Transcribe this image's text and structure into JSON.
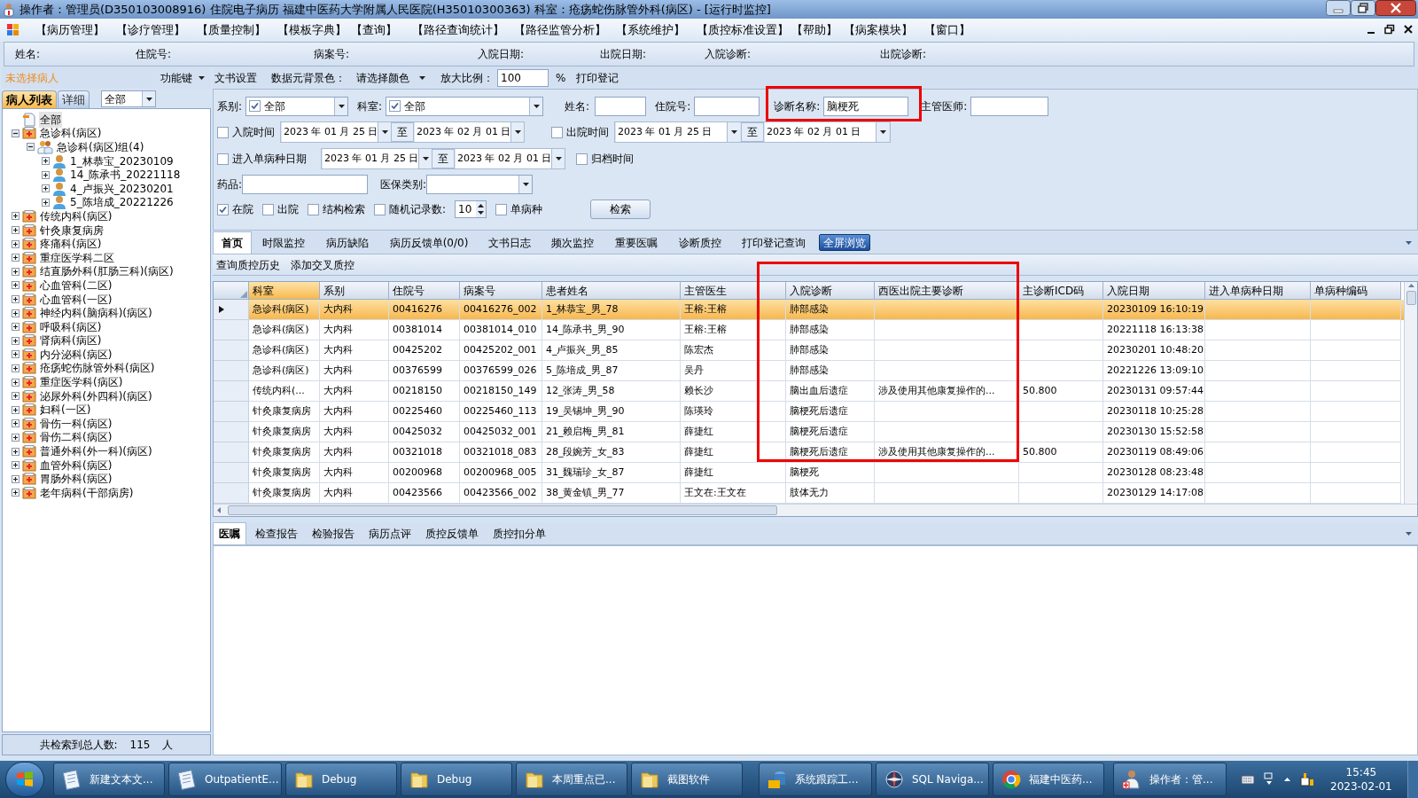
{
  "window": {
    "title": "操作者：管理员(D350103008916) 住院电子病历  福建中医药大学附属人民医院(H35010300363)  科室：疮疡蛇伤脉管外科(病区) - [运行时监控]"
  },
  "menu": [
    "【病历管理】",
    "【诊疗管理】",
    "【质量控制】",
    "【模板字典】",
    "【查询】",
    "【路径查询统计】",
    "【路径监管分析】",
    "【系统维护】",
    "【质控标准设置】",
    "【帮助】",
    "【病案模块】",
    "【窗口】"
  ],
  "patient_header": [
    "姓名:",
    "住院号:",
    "病案号:",
    "入院日期:",
    "出院日期:",
    "入院诊断:",
    "出院诊断:"
  ],
  "left_panel": {
    "status": "未选择病人",
    "function_key": "功能键",
    "tabs": [
      {
        "label": "病人列表",
        "selected": true
      },
      {
        "label": "详细",
        "selected": false
      }
    ],
    "filter": "全部",
    "tree": [
      {
        "label": "全部",
        "kind": "root",
        "selected": true
      },
      {
        "label": "急诊科(病区)",
        "kind": "ward",
        "selected": false,
        "expanded": true,
        "children": [
          {
            "label": "急诊科(病区)组(4)",
            "kind": "group",
            "selected": false,
            "expanded": true,
            "children": [
              {
                "label": "1_林恭宝_20230109",
                "kind": "patient",
                "selected": false,
                "expanded": false
              },
              {
                "label": "14_陈承书_20221118",
                "kind": "patient",
                "selected": false,
                "expanded": false
              },
              {
                "label": "4_卢振兴_20230201",
                "kind": "patient",
                "selected": false,
                "expanded": false
              },
              {
                "label": "5_陈培成_20221226",
                "kind": "patient",
                "selected": false,
                "expanded": false
              }
            ]
          }
        ]
      },
      {
        "label": "传统内科(病区)",
        "kind": "ward",
        "selected": false,
        "expanded": false
      },
      {
        "label": "针灸康复病房",
        "kind": "ward",
        "selected": false,
        "expanded": false
      },
      {
        "label": "疼痛科(病区)",
        "kind": "ward",
        "selected": false,
        "expanded": false
      },
      {
        "label": "重症医学科二区",
        "kind": "ward",
        "selected": false,
        "expanded": false
      },
      {
        "label": "结直肠外科(肛肠三科)(病区)",
        "kind": "ward",
        "selected": false,
        "expanded": false
      },
      {
        "label": "心血管科(二区)",
        "kind": "ward",
        "selected": false,
        "expanded": false
      },
      {
        "label": "心血管科(一区)",
        "kind": "ward",
        "selected": false,
        "expanded": false
      },
      {
        "label": "神经内科(脑病科)(病区)",
        "kind": "ward",
        "selected": false,
        "expanded": false
      },
      {
        "label": "呼吸科(病区)",
        "kind": "ward",
        "selected": false,
        "expanded": false
      },
      {
        "label": "肾病科(病区)",
        "kind": "ward",
        "selected": false,
        "expanded": false
      },
      {
        "label": "内分泌科(病区)",
        "kind": "ward",
        "selected": false,
        "expanded": false
      },
      {
        "label": "疮疡蛇伤脉管外科(病区)",
        "kind": "ward",
        "selected": false,
        "expanded": false
      },
      {
        "label": "重症医学科(病区)",
        "kind": "ward",
        "selected": false,
        "expanded": false
      },
      {
        "label": "泌尿外科(外四科)(病区)",
        "kind": "ward",
        "selected": false,
        "expanded": false
      },
      {
        "label": "妇科(一区)",
        "kind": "ward",
        "selected": false,
        "expanded": false
      },
      {
        "label": "骨伤一科(病区)",
        "kind": "ward",
        "selected": false,
        "expanded": false
      },
      {
        "label": "骨伤二科(病区)",
        "kind": "ward",
        "selected": false,
        "expanded": false
      },
      {
        "label": "普通外科(外一科)(病区)",
        "kind": "ward",
        "selected": false,
        "expanded": false
      },
      {
        "label": "血管外科(病区)",
        "kind": "ward",
        "selected": false,
        "expanded": false
      },
      {
        "label": "胃肠外科(病区)",
        "kind": "ward",
        "selected": false,
        "expanded": false
      },
      {
        "label": "老年病科(干部病房)",
        "kind": "ward",
        "selected": false,
        "expanded": false
      }
    ],
    "footer_label": "共检索到总人数:",
    "footer_count": "115",
    "footer_unit": "人"
  },
  "toolbar": {
    "doc_settings": "文书设置",
    "bg_label": "数据元背景色：",
    "bg_select": "请选择颜色",
    "zoom_label": "放大比例：",
    "zoom_value": "100",
    "percent": "%",
    "print": "打印登记"
  },
  "filters": {
    "category": {
      "label": "系别:",
      "checked": true,
      "value": "全部"
    },
    "department": {
      "label": "科室:",
      "checked": true,
      "value": "全部"
    },
    "name": {
      "label": "姓名:"
    },
    "inpatient_no": {
      "label": "住院号:"
    },
    "diagnosis": {
      "label": "诊断名称:",
      "value": "脑梗死"
    },
    "doctor": {
      "label": "主管医师:"
    },
    "admit_time": {
      "label": "入院时间",
      "checked": false,
      "from": "2023 年 01 月 25 日",
      "to_label": "至",
      "to": "2023 年 02 月 01 日"
    },
    "discharge_time": {
      "label": "出院时间",
      "checked": false,
      "from": "2023 年 01 月 25 日",
      "to_label": "至",
      "to": "2023 年 02 月 01 日"
    },
    "single_disease_date": {
      "label": "进入单病种日期",
      "checked": false,
      "from": "2023 年 01 月 25 日",
      "to_label": "至",
      "to": "2023 年 02 月 01 日"
    },
    "archive_time": {
      "label": "归档时间",
      "checked": false
    },
    "drug": {
      "label": "药品:"
    },
    "insurance": {
      "label": "医保类别:"
    },
    "options": [
      {
        "label": "在院",
        "checked": true
      },
      {
        "label": "出院",
        "checked": false
      },
      {
        "label": "结构检索",
        "checked": false
      },
      {
        "label": "随机记录数:",
        "checked": false,
        "count": "10"
      },
      {
        "label": "单病种",
        "checked": false
      }
    ],
    "search_button": "检索"
  },
  "tabs": [
    {
      "label": "首页",
      "selected": true,
      "kind": "tab"
    },
    {
      "label": "时限监控",
      "selected": false,
      "kind": "tab"
    },
    {
      "label": "病历缺陷",
      "selected": false,
      "kind": "tab"
    },
    {
      "label": "病历反馈单(0/0)",
      "selected": false,
      "kind": "tab"
    },
    {
      "label": "文书日志",
      "selected": false,
      "kind": "tab"
    },
    {
      "label": "频次监控",
      "selected": false,
      "kind": "tab"
    },
    {
      "label": "重要医嘱",
      "selected": false,
      "kind": "tab"
    },
    {
      "label": "诊断质控",
      "selected": false,
      "kind": "tab"
    },
    {
      "label": "打印登记查询",
      "selected": false,
      "kind": "tab"
    },
    {
      "label": "全屏浏览",
      "selected": false,
      "kind": "button"
    }
  ],
  "subtoolbar": [
    "查询质控历史",
    "添加交叉质控"
  ],
  "table": {
    "columns": [
      {
        "label": "科室",
        "selected": true
      },
      {
        "label": "系别",
        "selected": false
      },
      {
        "label": "住院号",
        "selected": false
      },
      {
        "label": "病案号",
        "selected": false
      },
      {
        "label": "患者姓名",
        "selected": false
      },
      {
        "label": "主管医生",
        "selected": false
      },
      {
        "label": "入院诊断",
        "selected": false
      },
      {
        "label": "西医出院主要诊断",
        "selected": false
      },
      {
        "label": "主诊断ICD码",
        "selected": false
      },
      {
        "label": "入院日期",
        "selected": false
      },
      {
        "label": "进入单病种日期",
        "selected": false
      },
      {
        "label": "单病种编码",
        "selected": false
      }
    ],
    "rows": [
      {
        "selected": true,
        "cells": [
          "急诊科(病区)",
          "大内科",
          "00416276",
          "00416276_002",
          "1_林恭宝_男_78",
          "王榕:王榕",
          "肺部感染",
          null,
          null,
          "20230109 16:10:19",
          null,
          null
        ]
      },
      {
        "selected": false,
        "cells": [
          "急诊科(病区)",
          "大内科",
          "00381014",
          "00381014_010",
          "14_陈承书_男_90",
          "王榕:王榕",
          "肺部感染",
          null,
          null,
          "20221118 16:13:38",
          null,
          null
        ]
      },
      {
        "selected": false,
        "cells": [
          "急诊科(病区)",
          "大内科",
          "00425202",
          "00425202_001",
          "4_卢振兴_男_85",
          "陈宏杰",
          "肺部感染",
          null,
          null,
          "20230201 10:48:20",
          null,
          null
        ]
      },
      {
        "selected": false,
        "cells": [
          "急诊科(病区)",
          "大内科",
          "00376599",
          "00376599_026",
          "5_陈培成_男_87",
          "吴丹",
          "肺部感染",
          null,
          null,
          "20221226 13:09:10",
          null,
          null
        ]
      },
      {
        "selected": false,
        "cells": [
          "传统内科(...",
          "大内科",
          "00218150",
          "00218150_149",
          "12_张涛_男_58",
          "赖长沙",
          "脑出血后遗症",
          "涉及使用其他康复操作的...",
          "50.800",
          "20230131 09:57:44",
          null,
          null
        ]
      },
      {
        "selected": false,
        "cells": [
          "针灸康复病房",
          "大内科",
          "00225460",
          "00225460_113",
          "19_吴锡坤_男_90",
          "陈瑛玲",
          "脑梗死后遗症",
          null,
          null,
          "20230118 10:25:28",
          null,
          null
        ]
      },
      {
        "selected": false,
        "cells": [
          "针灸康复病房",
          "大内科",
          "00425032",
          "00425032_001",
          "21_赖启梅_男_81",
          "薛捷红",
          "脑梗死后遗症",
          null,
          null,
          "20230130 15:52:58",
          null,
          null
        ]
      },
      {
        "selected": false,
        "cells": [
          "针灸康复病房",
          "大内科",
          "00321018",
          "00321018_083",
          "28_段婉芳_女_83",
          "薛捷红",
          "脑梗死后遗症",
          "涉及使用其他康复操作的...",
          "50.800",
          "20230119 08:49:06",
          null,
          null
        ]
      },
      {
        "selected": false,
        "cells": [
          "针灸康复病房",
          "大内科",
          "00200968",
          "00200968_005",
          "31_魏瑞珍_女_87",
          "薛捷红",
          "脑梗死",
          null,
          null,
          "20230128 08:23:48",
          null,
          null
        ]
      },
      {
        "selected": false,
        "cells": [
          "针灸康复病房",
          "大内科",
          "00423566",
          "00423566_002",
          "38_黄金镇_男_77",
          "王文在:王文在",
          "肢体无力",
          null,
          null,
          "20230129 14:17:08",
          null,
          null
        ]
      }
    ]
  },
  "bottom_tabs": [
    {
      "label": "医嘱",
      "selected": true
    },
    {
      "label": "检查报告",
      "selected": false
    },
    {
      "label": "检验报告",
      "selected": false
    },
    {
      "label": "病历点评",
      "selected": false
    },
    {
      "label": "质控反馈单",
      "selected": false
    },
    {
      "label": "质控扣分单",
      "selected": false
    }
  ],
  "taskbar": {
    "items": [
      {
        "label": "新建文本文...",
        "kind": "notepad"
      },
      {
        "label": "OutpatientE...",
        "kind": "notepad"
      },
      {
        "label": "Debug",
        "kind": "folder"
      },
      {
        "label": "Debug",
        "kind": "folder"
      },
      {
        "label": "本周重点已...",
        "kind": "folder"
      },
      {
        "label": "截图软件",
        "kind": "folder"
      },
      {
        "label": "系统跟踪工...",
        "kind": "sql"
      },
      {
        "label": "SQL Naviga...",
        "kind": "compass"
      },
      {
        "label": "福建中医药...",
        "kind": "browser"
      },
      {
        "label": "操作者：管...",
        "kind": "doctor"
      }
    ],
    "clock_time": "15:45",
    "clock_date": "2023-02-01"
  }
}
